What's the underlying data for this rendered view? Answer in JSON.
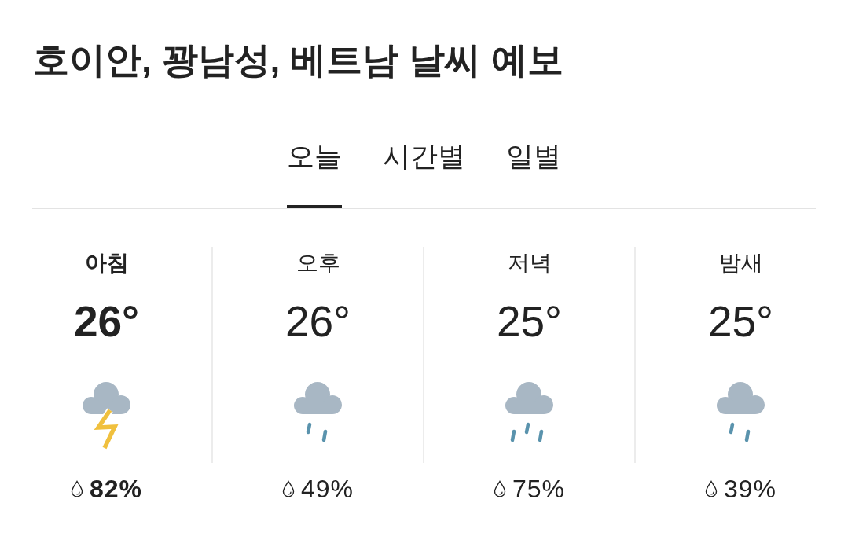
{
  "title": "호이안, 꽝남성, 베트남 날씨 예보",
  "tabs": [
    {
      "label": "오늘",
      "selected": true
    },
    {
      "label": "시간별",
      "selected": false
    },
    {
      "label": "일별",
      "selected": false
    }
  ],
  "periods": [
    {
      "label": "아침",
      "temperature": "26°",
      "kind": "thunder",
      "precipitation": "82%",
      "selected": true
    },
    {
      "label": "오후",
      "temperature": "26°",
      "kind": "rain",
      "precipitation": "49%",
      "selected": false
    },
    {
      "label": "저녁",
      "temperature": "25°",
      "kind": "heavy-rain",
      "precipitation": "75%",
      "selected": false
    },
    {
      "label": "밤새",
      "temperature": "25°",
      "kind": "rain",
      "precipitation": "39%",
      "selected": false
    }
  ]
}
